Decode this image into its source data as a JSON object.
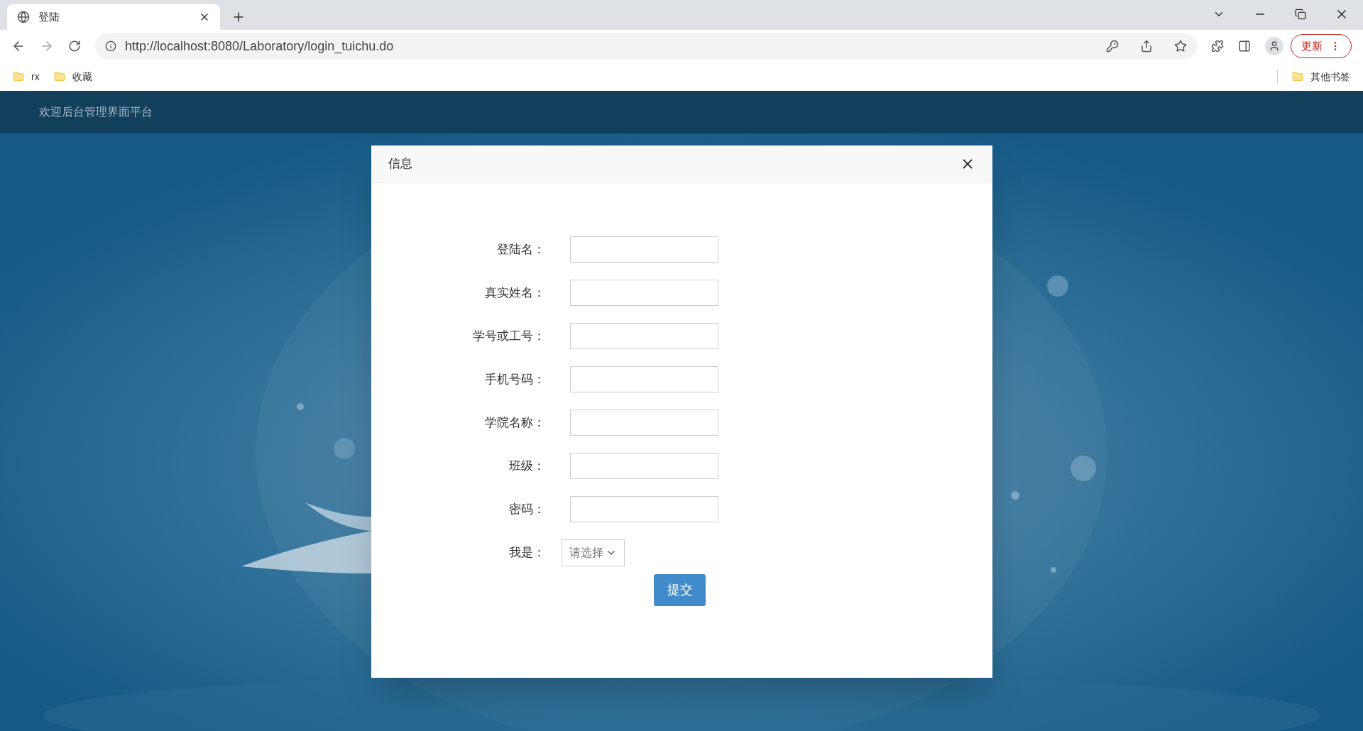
{
  "browser": {
    "tab": {
      "title": "登陆"
    },
    "address": "http://localhost:8080/Laboratory/login_tuichu.do",
    "update_button": "更新",
    "bookmarks": [
      {
        "label": "rx"
      },
      {
        "label": "收藏"
      }
    ],
    "other_bookmarks": "其他书签"
  },
  "header": {
    "title": "欢迎后台管理界面平台"
  },
  "dialog": {
    "title": "信息",
    "fields": [
      {
        "kind": "text",
        "label": "登陆名："
      },
      {
        "kind": "text",
        "label": "真实姓名："
      },
      {
        "kind": "text",
        "label": "学号或工号："
      },
      {
        "kind": "text",
        "label": "手机号码："
      },
      {
        "kind": "text",
        "label": "学院名称："
      },
      {
        "kind": "text",
        "label": "班级："
      },
      {
        "kind": "password",
        "label": "密码："
      },
      {
        "kind": "select",
        "label": "我是：",
        "value": "请选择"
      }
    ],
    "submit": "提交"
  }
}
